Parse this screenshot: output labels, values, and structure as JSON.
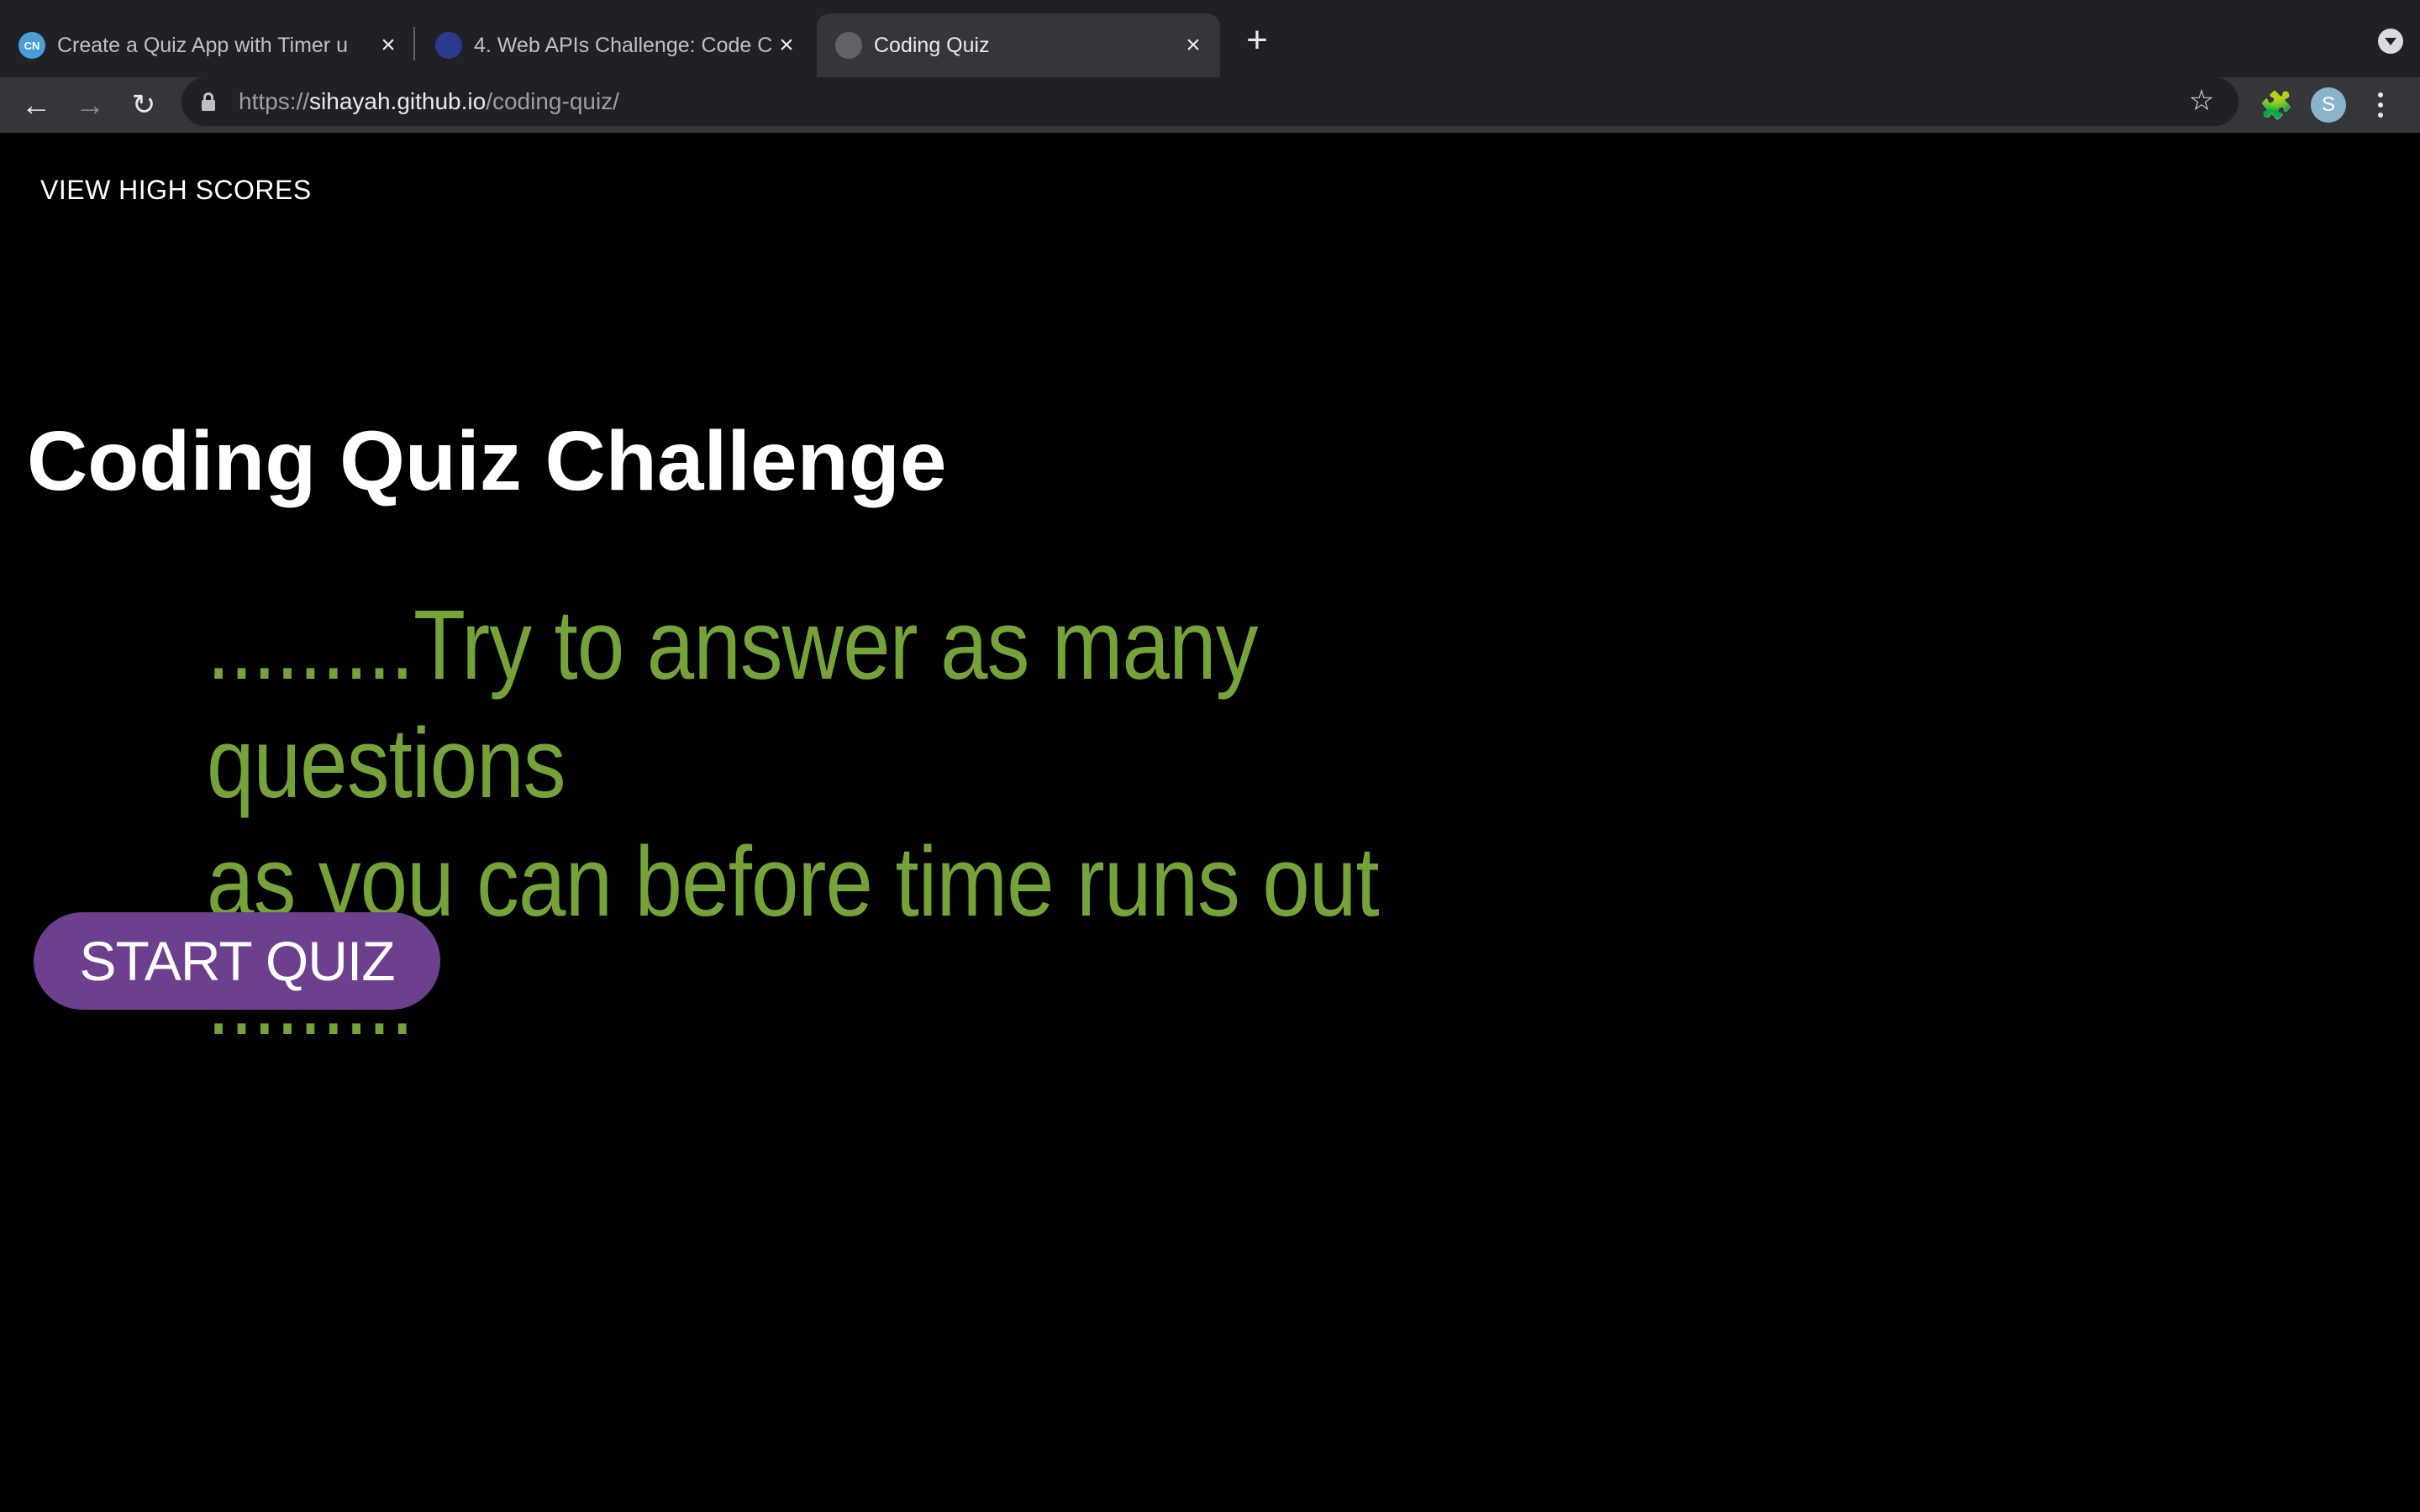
{
  "browser": {
    "tabs": [
      {
        "title": "Create a Quiz App with Timer u",
        "favicon_text": "CN",
        "favicon_color": "#4a9fd8",
        "active": false
      },
      {
        "title": "4. Web APIs Challenge: Code C",
        "favicon_text": "",
        "favicon_color": "#2b3a8c",
        "active": false
      },
      {
        "title": "Coding Quiz",
        "favicon_text": "",
        "favicon_color": "#5f6368",
        "active": true
      }
    ],
    "close_symbol": "×",
    "new_tab_symbol": "+",
    "url": {
      "scheme": "https://",
      "host": "sihayah.github.io",
      "path": "/coding-quiz/"
    },
    "avatar_letter": "S"
  },
  "page": {
    "high_scores_label": "VIEW HIGH SCORES",
    "title": "Coding Quiz Challenge",
    "intro_line1": ".........Try to answer as many questions",
    "intro_line2": "as you can before time runs out .........",
    "start_button_label": "START QUIZ"
  },
  "colors": {
    "intro_text": "#75a33a",
    "start_button_bg": "#6d3f8f",
    "background": "#000000"
  }
}
